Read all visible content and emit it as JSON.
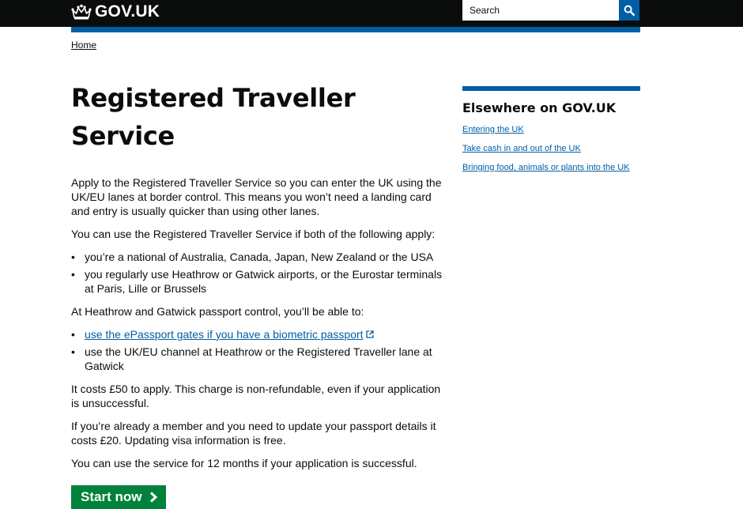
{
  "header": {
    "logo_text": "GOV.UK",
    "search_placeholder": "Search"
  },
  "breadcrumb": {
    "home_label": "Home"
  },
  "main": {
    "title": "Registered Traveller Service",
    "intro": "Apply to the Registered Traveller Service so you can enter the UK using the UK/EU lanes at border control. This means you won’t need a landing card and entry is usually quicker than using other lanes.",
    "conditions_lead": "You can use the Registered Traveller Service if both of the following apply:",
    "conditions": [
      "you’re a national of Australia, Canada, Japan, New Zealand or the USA",
      "you regularly use Heathrow or Gatwick airports, or the Eurostar terminals at Paris, Lille or Brussels"
    ],
    "benefits_lead": "At Heathrow and Gatwick passport control, you’ll be able to:",
    "benefit_link": "use the ePassport gates if you have a biometric passport",
    "benefit_text": "use the UK/EU channel at Heathrow or the Registered Traveller lane at Gatwick",
    "cost": "It costs £50 to apply. This charge is non-refundable, even if your application is unsuccessful.",
    "update": "If you’re already a member and you need to update your passport details it costs £20. Updating visa information is free.",
    "duration": "You can use the service for 12 months if your application is successful.",
    "start_button": "Start now"
  },
  "aside": {
    "heading": "Elsewhere on GOV.UK",
    "links": [
      "Entering the UK",
      "Take cash in and out of the UK",
      "Bringing food, animals or plants into the UK"
    ]
  },
  "colors": {
    "header_bg": "#0b0c0c",
    "brand_blue": "#005ea5",
    "button_green": "#00823b",
    "text": "#0b0c0c"
  },
  "icons": [
    "crown-icon",
    "search-icon",
    "external-link-icon",
    "arrow-right-icon"
  ]
}
